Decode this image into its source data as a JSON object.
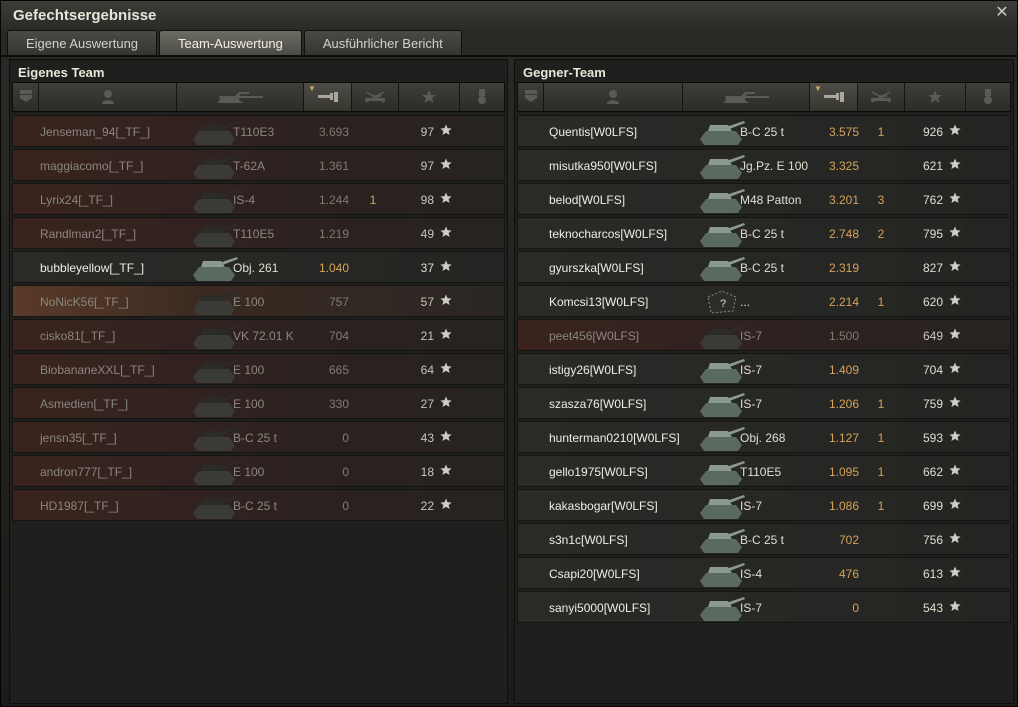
{
  "window": {
    "title": "Gefechtsergebnisse"
  },
  "tabs": [
    {
      "label": "Eigene Auswertung",
      "active": false
    },
    {
      "label": "Team-Auswertung",
      "active": true
    },
    {
      "label": "Ausführlicher Bericht",
      "active": false
    }
  ],
  "own_team": {
    "title": "Eigenes Team",
    "players": [
      {
        "name": "Jenseman_94[_TF_]",
        "tank": "T110E3",
        "damage": "3.693",
        "kills": "",
        "xp": "97",
        "dead": true
      },
      {
        "name": "maggiacomo[_TF_]",
        "tank": "T-62A",
        "damage": "1.361",
        "kills": "",
        "xp": "97",
        "dead": true
      },
      {
        "name": "Lyrix24[_TF_]",
        "tank": "IS-4",
        "damage": "1.244",
        "kills": "1",
        "xp": "98",
        "dead": true
      },
      {
        "name": "Randlman2[_TF_]",
        "tank": "T110E5",
        "damage": "1.219",
        "kills": "",
        "xp": "49",
        "dead": true
      },
      {
        "name": "bubbleyellow[_TF_]",
        "tank": "Obj. 261",
        "damage": "1.040",
        "kills": "",
        "xp": "37",
        "dead": false
      },
      {
        "name": "NoNicK56[_TF_]",
        "tank": "E 100",
        "damage": "757",
        "kills": "",
        "xp": "57",
        "dead": true,
        "highlight": true
      },
      {
        "name": "cisko81[_TF_]",
        "tank": "VK 72.01 K",
        "damage": "704",
        "kills": "",
        "xp": "21",
        "dead": true
      },
      {
        "name": "BiobananeXXL[_TF_]",
        "tank": "E 100",
        "damage": "665",
        "kills": "",
        "xp": "64",
        "dead": true
      },
      {
        "name": "Asmedien[_TF_]",
        "tank": "E 100",
        "damage": "330",
        "kills": "",
        "xp": "27",
        "dead": true
      },
      {
        "name": "jensn35[_TF_]",
        "tank": "B-C 25 t",
        "damage": "0",
        "kills": "",
        "xp": "43",
        "dead": true
      },
      {
        "name": "andron777[_TF_]",
        "tank": "E 100",
        "damage": "0",
        "kills": "",
        "xp": "18",
        "dead": true
      },
      {
        "name": "HD1987[_TF_]",
        "tank": "B-C 25 t",
        "damage": "0",
        "kills": "",
        "xp": "22",
        "dead": true
      }
    ]
  },
  "enemy_team": {
    "title": "Gegner-Team",
    "players": [
      {
        "name": "Quentis[W0LFS]",
        "tank": "B-C 25 t",
        "damage": "3.575",
        "kills": "1",
        "xp": "926",
        "dead": false
      },
      {
        "name": "misutka950[W0LFS]",
        "tank": "Jg.Pz. E 100",
        "damage": "3.325",
        "kills": "",
        "xp": "621",
        "dead": false
      },
      {
        "name": "belod[W0LFS]",
        "tank": "M48 Patton",
        "damage": "3.201",
        "kills": "3",
        "xp": "762",
        "dead": false
      },
      {
        "name": "teknocharcos[W0LFS]",
        "tank": "B-C 25 t",
        "damage": "2.748",
        "kills": "2",
        "xp": "795",
        "dead": false
      },
      {
        "name": "gyurszka[W0LFS]",
        "tank": "B-C 25 t",
        "damage": "2.319",
        "kills": "",
        "xp": "827",
        "dead": false
      },
      {
        "name": "Komcsi13[W0LFS]",
        "tank": "...",
        "damage": "2.214",
        "kills": "1",
        "xp": "620",
        "dead": false,
        "unknown": true
      },
      {
        "name": "peet456[W0LFS]",
        "tank": "IS-7",
        "damage": "1.500",
        "kills": "",
        "xp": "649",
        "dead": true
      },
      {
        "name": "istigy26[W0LFS]",
        "tank": "IS-7",
        "damage": "1.409",
        "kills": "",
        "xp": "704",
        "dead": false
      },
      {
        "name": "szasza76[W0LFS]",
        "tank": "IS-7",
        "damage": "1.206",
        "kills": "1",
        "xp": "759",
        "dead": false
      },
      {
        "name": "hunterman0210[W0LFS]",
        "tank": "Obj. 268",
        "damage": "1.127",
        "kills": "1",
        "xp": "593",
        "dead": false
      },
      {
        "name": "gello1975[W0LFS]",
        "tank": "T110E5",
        "damage": "1.095",
        "kills": "1",
        "xp": "662",
        "dead": false
      },
      {
        "name": "kakasbogar[W0LFS]",
        "tank": "IS-7",
        "damage": "1.086",
        "kills": "1",
        "xp": "699",
        "dead": false
      },
      {
        "name": "s3n1c[W0LFS]",
        "tank": "B-C 25 t",
        "damage": "702",
        "kills": "",
        "xp": "756",
        "dead": false
      },
      {
        "name": "Csapi20[W0LFS]",
        "tank": "IS-4",
        "damage": "476",
        "kills": "",
        "xp": "613",
        "dead": false
      },
      {
        "name": "sanyi5000[W0LFS]",
        "tank": "IS-7",
        "damage": "0",
        "kills": "",
        "xp": "543",
        "dead": false
      }
    ]
  },
  "columns": [
    "squad-icon",
    "player-icon",
    "tank-icon",
    "damage-icon",
    "kills-icon",
    "xp-star-icon",
    "medal-icon"
  ],
  "colors": {
    "accent": "#d7a35a",
    "dead_row": "#3a231e",
    "text": "#e0ddd0"
  }
}
